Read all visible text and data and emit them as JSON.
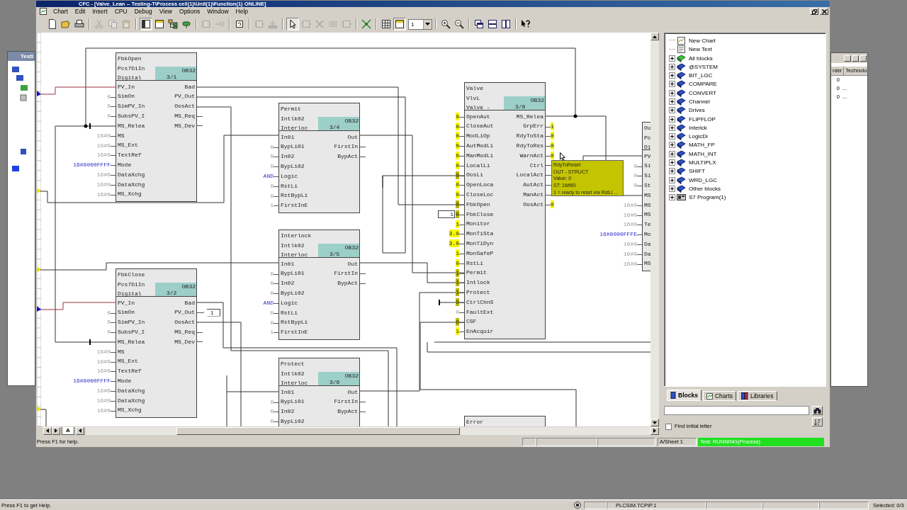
{
  "window": {
    "title": "CFC - [Valve_Lean -- Testing-T\\Process cell(1)\\Unit(1)\\Function(1) ONLINE]"
  },
  "menu": [
    "Chart",
    "Edit",
    "Insert",
    "CPU",
    "Debug",
    "View",
    "Options",
    "Window",
    "Help"
  ],
  "toolbar": {
    "buttons": [
      {
        "disabled": false,
        "on": false
      },
      {
        "disabled": false,
        "on": false
      },
      {
        "disabled": false,
        "on": false
      },
      {
        "disabled": true,
        "on": false
      },
      {
        "disabled": true,
        "on": false
      },
      {
        "disabled": true,
        "on": false
      },
      {
        "disabled": false,
        "on": true
      },
      {
        "disabled": false,
        "on": false
      },
      {
        "disabled": false,
        "on": false
      },
      {
        "disabled": false,
        "on": false
      },
      {
        "disabled": true,
        "on": false
      },
      {
        "disabled": true,
        "on": false
      },
      {
        "disabled": false,
        "on": false
      },
      {
        "disabled": true,
        "on": false
      },
      {
        "disabled": true,
        "on": false
      },
      {
        "disabled": false,
        "on": true
      },
      {
        "disabled": true,
        "on": false
      },
      {
        "disabled": true,
        "on": false
      },
      {
        "disabled": true,
        "on": false
      },
      {
        "disabled": true,
        "on": false
      },
      {
        "disabled": false,
        "on": false
      },
      {
        "disabled": false,
        "on": false
      },
      {
        "disabled": false,
        "on": true
      },
      {
        "disabled": false,
        "on": false
      },
      {
        "disabled": false,
        "on": false
      },
      {
        "disabled": false,
        "on": false
      },
      {
        "disabled": false,
        "on": false
      },
      {
        "disabled": false,
        "on": false
      },
      {
        "disabled": false,
        "on": false
      }
    ],
    "zoom_level": "1"
  },
  "chart": {
    "blocks": [
      {
        "header": [
          "FbkOpen",
          "Pcs7DiIn",
          "Digital"
        ],
        "task": "OB32",
        "sequence": "3/1",
        "inputs": [
          {
            "pin": "PV_In",
            "kind": "wired"
          },
          {
            "pin": "SimOn",
            "value": "0",
            "kind": "param"
          },
          {
            "pin": "SimPV_In",
            "value": "0",
            "kind": "param"
          },
          {
            "pin": "SubsPV_I",
            "value": "0",
            "kind": "param"
          },
          {
            "pin": "MS_Relea",
            "kind": "wired"
          },
          {
            "pin": "MS",
            "value": "16#0",
            "kind": "param"
          },
          {
            "pin": "MS_Ext",
            "value": "16#0",
            "kind": "param"
          },
          {
            "pin": "TextRef",
            "value": "16#0",
            "kind": "param"
          },
          {
            "pin": "Mode",
            "value": "16#8000FFFF",
            "kind": "set"
          },
          {
            "pin": "DataXchg",
            "value": "16#0",
            "kind": "param"
          },
          {
            "pin": "DataXchg",
            "value": "16#0",
            "kind": "param"
          },
          {
            "pin": "MS_Xchg",
            "value": "16#0",
            "kind": "param"
          }
        ],
        "outputs": [
          {
            "pin": "Bad",
            "kind": "wired"
          },
          {
            "pin": "PV_Out",
            "kind": "wired"
          },
          {
            "pin": "OosAct",
            "kind": "wired"
          },
          {
            "pin": "MS_Req",
            "kind": "open"
          },
          {
            "pin": "MS_Dev",
            "kind": "open"
          }
        ]
      },
      {
        "header": [
          "FbkClose",
          "Pcs7DiIn",
          "Digital"
        ],
        "task": "OB32",
        "sequence": "3/2",
        "inputs": [
          {
            "pin": "PV_In",
            "kind": "wired"
          },
          {
            "pin": "SimOn",
            "value": "0",
            "kind": "param"
          },
          {
            "pin": "SimPV_In",
            "value": "0",
            "kind": "param"
          },
          {
            "pin": "SubsPV_I",
            "value": "0",
            "kind": "param"
          },
          {
            "pin": "MS_Relea",
            "kind": "wired"
          },
          {
            "pin": "MS",
            "value": "16#0",
            "kind": "param"
          },
          {
            "pin": "MS_Ext",
            "value": "16#0",
            "kind": "param"
          },
          {
            "pin": "TextRef",
            "value": "16#0",
            "kind": "param"
          },
          {
            "pin": "Mode",
            "value": "16#8000FFFF",
            "kind": "set"
          },
          {
            "pin": "DataXchg",
            "value": "16#0",
            "kind": "param"
          },
          {
            "pin": "DataXchg",
            "value": "16#0",
            "kind": "param"
          },
          {
            "pin": "MS_Xchg",
            "value": "16#0",
            "kind": "param"
          }
        ],
        "outputs": [
          {
            "pin": "Bad",
            "kind": "wired"
          },
          {
            "pin": "PV_Out",
            "kind": "connector",
            "connector": "1"
          },
          {
            "pin": "OosAct",
            "kind": "wired"
          },
          {
            "pin": "MS_Req",
            "kind": "open"
          },
          {
            "pin": "MS_Dev",
            "kind": "open"
          }
        ]
      },
      {
        "header": [
          "Permit",
          "Intlk02",
          "Interloc"
        ],
        "task": "OB32",
        "sequence": "3/4",
        "inputs": [
          {
            "pin": "In01",
            "kind": "wired"
          },
          {
            "pin": "BypLi01",
            "value": "0",
            "kind": "param"
          },
          {
            "pin": "In02",
            "value": "0",
            "kind": "param"
          },
          {
            "pin": "BypLi02",
            "value": "0",
            "kind": "param"
          },
          {
            "pin": "Logic",
            "value": "AND",
            "kind": "set"
          },
          {
            "pin": "RstLi",
            "value": "0",
            "kind": "param"
          },
          {
            "pin": "RstBypLi",
            "value": "0",
            "kind": "param"
          },
          {
            "pin": "FirstInE",
            "value": "1",
            "kind": "param"
          }
        ],
        "outputs": [
          {
            "pin": "Out",
            "kind": "wired"
          },
          {
            "pin": "FirstIn",
            "kind": "open"
          },
          {
            "pin": "BypAct",
            "kind": "open"
          }
        ]
      },
      {
        "header": [
          "Interlock",
          "Intlk02",
          "Interloc"
        ],
        "task": "OB32",
        "sequence": "3/5",
        "inputs": [
          {
            "pin": "In01",
            "kind": "wired"
          },
          {
            "pin": "BypLi01",
            "value": "0",
            "kind": "param"
          },
          {
            "pin": "In02",
            "value": "0",
            "kind": "param"
          },
          {
            "pin": "BypLi02",
            "value": "0",
            "kind": "param"
          },
          {
            "pin": "Logic",
            "value": "AND",
            "kind": "set"
          },
          {
            "pin": "RstLi",
            "value": "0",
            "kind": "param"
          },
          {
            "pin": "RstBypLi",
            "value": "0",
            "kind": "param"
          },
          {
            "pin": "FirstInE",
            "value": "1",
            "kind": "param"
          }
        ],
        "outputs": [
          {
            "pin": "Out",
            "kind": "wired"
          },
          {
            "pin": "FirstIn",
            "kind": "open"
          },
          {
            "pin": "BypAct",
            "kind": "open"
          }
        ]
      },
      {
        "header": [
          "Protect",
          "Intlk02",
          "Interloc"
        ],
        "task": "OB32",
        "sequence": "3/6",
        "inputs": [
          {
            "pin": "In01",
            "kind": "wired"
          },
          {
            "pin": "BypLi01",
            "value": "0",
            "kind": "param"
          },
          {
            "pin": "In02",
            "value": "0",
            "kind": "param"
          },
          {
            "pin": "BypLi02",
            "value": "0",
            "kind": "param"
          }
        ],
        "outputs": [
          {
            "pin": "Out",
            "kind": "wired"
          },
          {
            "pin": "FirstIn",
            "kind": "open"
          },
          {
            "pin": "BypAct",
            "kind": "open"
          }
        ]
      },
      {
        "header": [
          "Valve",
          "VlvL",
          "Valve -"
        ],
        "task": "OB32",
        "sequence": "3/8",
        "inputs": [
          {
            "pin": "OpenAut",
            "value": "0",
            "kind": "online"
          },
          {
            "pin": "CloseAut",
            "value": "0",
            "kind": "online"
          },
          {
            "pin": "ModLiOp",
            "value": "0",
            "kind": "online"
          },
          {
            "pin": "AutModLi",
            "value": "0",
            "kind": "online"
          },
          {
            "pin": "ManModLi",
            "value": "0",
            "kind": "online"
          },
          {
            "pin": "LocalLi",
            "value": "0",
            "kind": "online"
          },
          {
            "pin": "OosLi",
            "value": "0",
            "kind": "linked"
          },
          {
            "pin": "OpenLoca",
            "value": "0",
            "kind": "online"
          },
          {
            "pin": "CloseLoc",
            "value": "0",
            "kind": "online"
          },
          {
            "pin": "FbkOpen",
            "value": "0",
            "kind": "linked"
          },
          {
            "pin": "FbkClose",
            "value": "0",
            "kind": "linked",
            "connector": "1"
          },
          {
            "pin": "Monitor",
            "value": "1",
            "kind": "online"
          },
          {
            "pin": "MonTiSta",
            "value": "3.0",
            "kind": "online"
          },
          {
            "pin": "MonTiDyn",
            "value": "3.0",
            "kind": "online"
          },
          {
            "pin": "MonSafeP",
            "value": "1",
            "kind": "online"
          },
          {
            "pin": "RstLi",
            "value": "0",
            "kind": "online"
          },
          {
            "pin": "Permit",
            "value": "1",
            "kind": "linked"
          },
          {
            "pin": "Intlock",
            "value": "1",
            "kind": "linked"
          },
          {
            "pin": "Protect",
            "value": "1",
            "kind": "linked"
          },
          {
            "pin": "CtrlChnS",
            "value": "0",
            "kind": "linked"
          },
          {
            "pin": "FaultExt",
            "value": "0",
            "kind": "param"
          },
          {
            "pin": "CSF",
            "value": "0",
            "kind": "linked"
          },
          {
            "pin": "EnAcquir",
            "value": "1",
            "kind": "online"
          }
        ],
        "outputs": [
          {
            "pin": "MS_Relea",
            "kind": "wired"
          },
          {
            "pin": "GrpErr",
            "value": "1",
            "kind": "online"
          },
          {
            "pin": "RdyToSta",
            "value": "0",
            "kind": "online"
          },
          {
            "pin": "RdyToRes",
            "value": "0",
            "kind": "online"
          },
          {
            "pin": "WarnAct",
            "value": "0",
            "kind": "online"
          },
          {
            "pin": "Ctrl",
            "kind": "open"
          },
          {
            "pin": "LocalAct",
            "kind": "open"
          },
          {
            "pin": "AutAct",
            "kind": "open"
          },
          {
            "pin": "ManAct",
            "kind": "open"
          },
          {
            "pin": "OosAct",
            "value": "0",
            "kind": "online"
          }
        ]
      },
      {
        "header": [
          "Ou",
          "Pc",
          "Di"
        ],
        "inputs": [
          {
            "pin": "PV",
            "kind": "wired"
          },
          {
            "pin": "Si",
            "value": "0",
            "kind": "param"
          },
          {
            "pin": "Si",
            "value": "0",
            "kind": "param"
          },
          {
            "pin": "St",
            "value": "0",
            "kind": "param"
          },
          {
            "pin": "MS",
            "kind": "wired"
          },
          {
            "pin": "MS",
            "value": "16#0",
            "kind": "param"
          },
          {
            "pin": "MS",
            "value": "16#0",
            "kind": "param"
          },
          {
            "pin": "Te",
            "value": "16#0",
            "kind": "param"
          },
          {
            "pin": "Mo",
            "value": "16#8000FFFE",
            "kind": "set"
          },
          {
            "pin": "Da",
            "value": "16#0",
            "kind": "param"
          },
          {
            "pin": "Da",
            "value": "16#0",
            "kind": "param"
          },
          {
            "pin": "MS",
            "value": "16#0",
            "kind": "param"
          }
        ]
      },
      {
        "header": [
          "Error"
        ]
      }
    ],
    "tooltip": [
      "RdyToReset",
      "OUT - STRUCT",
      "Value: 0",
      "ST: 16#80",
      "1 = ready to reset via RstLi ..."
    ],
    "sheet_tab": "A"
  },
  "library_panel": {
    "tree": [
      {
        "label": "New Chart",
        "kind": "chart"
      },
      {
        "label": "New Text",
        "kind": "text"
      },
      {
        "label": "All blocks",
        "kind": "all"
      },
      {
        "label": "@SYSTEM",
        "kind": "library"
      },
      {
        "label": "BIT_LGC",
        "kind": "library"
      },
      {
        "label": "COMPARE",
        "kind": "library"
      },
      {
        "label": "CONVERT",
        "kind": "library"
      },
      {
        "label": "Channel",
        "kind": "library"
      },
      {
        "label": "Drives",
        "kind": "library"
      },
      {
        "label": "FLIPFLOP",
        "kind": "library"
      },
      {
        "label": "Interlck",
        "kind": "library"
      },
      {
        "label": "LogicDi",
        "kind": "library"
      },
      {
        "label": "MATH_FP",
        "kind": "library"
      },
      {
        "label": "MATH_INT",
        "kind": "library"
      },
      {
        "label": "MULTIPLX",
        "kind": "library"
      },
      {
        "label": "SHIFT",
        "kind": "library"
      },
      {
        "label": "WRD_LGC",
        "kind": "library"
      },
      {
        "label": "Other blocks",
        "kind": "library"
      },
      {
        "label": "S7 Program(1)",
        "kind": "program"
      }
    ],
    "tabs": [
      {
        "label": "Blocks",
        "selected": true
      },
      {
        "label": "Charts",
        "selected": false
      },
      {
        "label": "Libraries",
        "selected": false
      }
    ],
    "find_initial_letter": {
      "label": "Find initial letter",
      "checked": false
    }
  },
  "status_bar": {
    "help": "Press F1 for help.",
    "sheet": "A/Sheet 1",
    "mode": "Test: RUNNING(Process)"
  },
  "background_windows": [
    {
      "title": "Testi"
    },
    {
      "columns": [
        "rder",
        "Technolo"
      ],
      "rows": [
        [
          "0"
        ],
        [
          "0",
          "..."
        ],
        [
          "0",
          "..."
        ]
      ]
    }
  ],
  "main_status_bar": {
    "help": "Press F1 to get Help.",
    "connection": "PLCSIM.TCPIP.1",
    "selection": "Selected: 0/3"
  }
}
